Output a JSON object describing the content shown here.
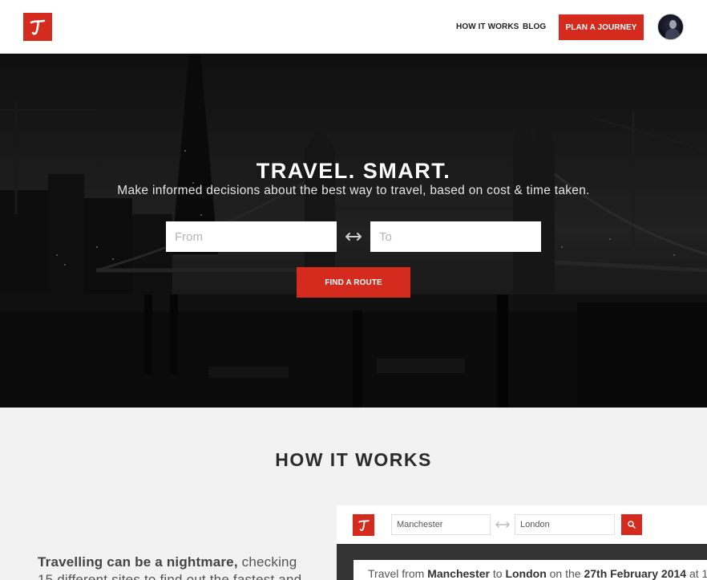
{
  "header": {
    "logo_icon": "t-logo-icon",
    "nav": [
      {
        "label": "HOW IT WORKS"
      },
      {
        "label": "BLOG"
      }
    ],
    "cta_label": "PLAN A JOURNEY",
    "avatar_icon": "user-avatar"
  },
  "hero": {
    "title": "TRAVEL. SMART.",
    "subtitle": "Make informed decisions about the best way to travel, based on cost & time taken.",
    "from_placeholder": "From",
    "to_placeholder": "To",
    "swap_icon": "swap-arrows-icon",
    "find_label": "FIND A ROUTE"
  },
  "how_it_works": {
    "title": "HOW IT WORKS",
    "intro_bold": "Travelling can be a nightmare,",
    "intro_rest": " checking 15 different sites to find out the fastest and"
  },
  "preview": {
    "from_value": "Manchester",
    "to_value": "London",
    "search_icon": "search-icon",
    "result_prefix": "Travel from ",
    "result_from": "Manchester",
    "result_mid": " to ",
    "result_to": "London",
    "result_on": " on the ",
    "result_date": "27th February 2014",
    "result_suffix": " at 1"
  },
  "colors": {
    "accent": "#d52b1e",
    "text_dark": "#2b2b2b",
    "section_bg": "#f2f2f2"
  }
}
